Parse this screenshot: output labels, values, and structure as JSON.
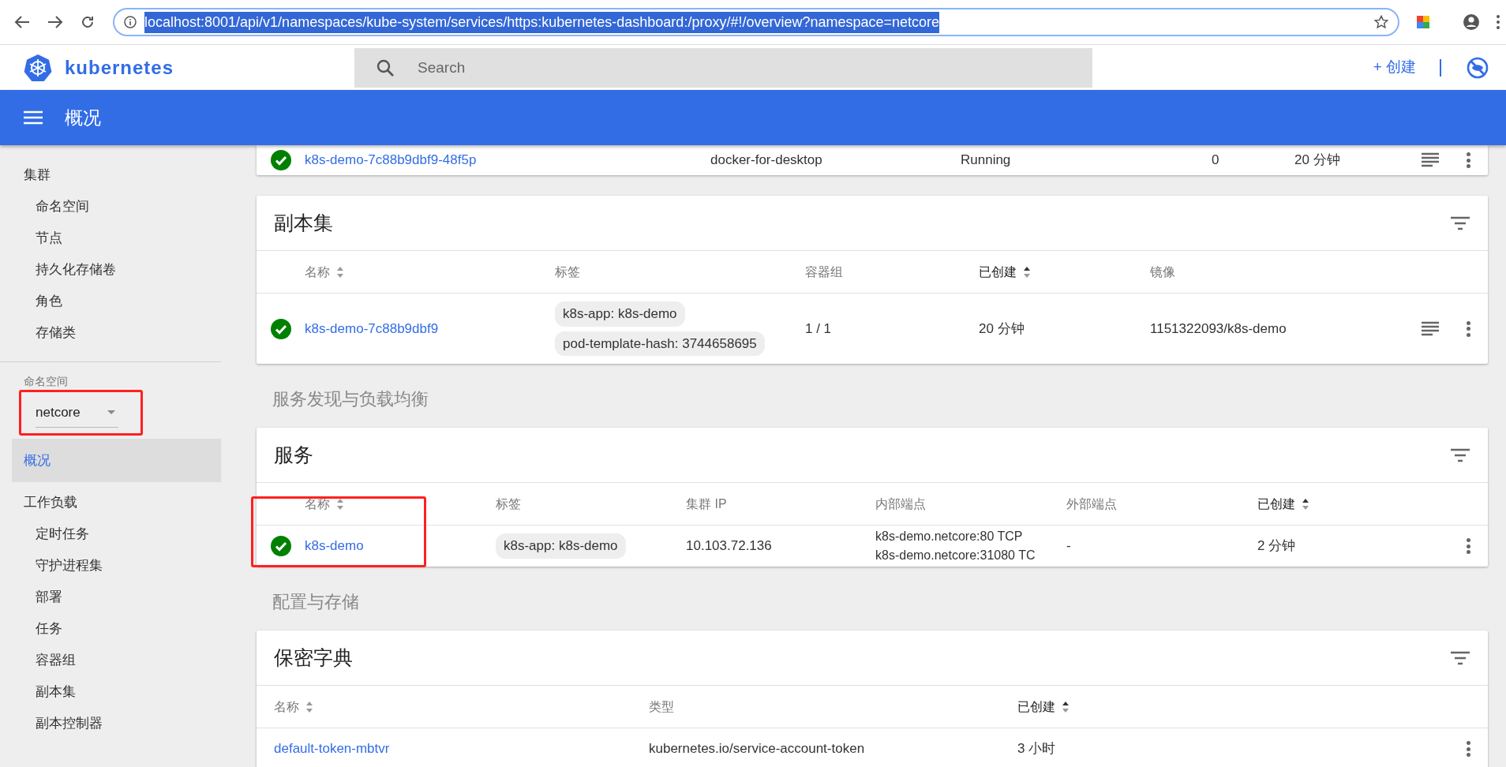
{
  "browser": {
    "url": "localhost:8001/api/v1/namespaces/kube-system/services/https:kubernetes-dashboard:/proxy/#!/overview?namespace=netcore",
    "url_selected": true
  },
  "app_header": {
    "brand": "kubernetes",
    "search": {
      "placeholder": "Search"
    },
    "create_button": "+ 创建"
  },
  "title_bar": {
    "title": "概况"
  },
  "sidebar": {
    "top_sections": [
      {
        "label": "集群",
        "selected": false,
        "children": [
          {
            "label": "命名空间",
            "selected": false
          },
          {
            "label": "节点",
            "selected": false
          },
          {
            "label": "持久化存储卷",
            "selected": false
          },
          {
            "label": "角色",
            "selected": false
          },
          {
            "label": "存储类",
            "selected": false
          }
        ]
      }
    ],
    "namespace_selector": {
      "label": "命名空间",
      "value": "netcore",
      "highlighted": true
    },
    "sections": [
      {
        "label": "概况",
        "selected": true
      },
      {
        "label": "工作负载",
        "selected": false,
        "children": [
          {
            "label": "定时任务",
            "selected": false
          },
          {
            "label": "守护进程集",
            "selected": false
          },
          {
            "label": "部署",
            "selected": false
          },
          {
            "label": "任务",
            "selected": false
          },
          {
            "label": "容器组",
            "selected": false
          },
          {
            "label": "副本集",
            "selected": false
          },
          {
            "label": "副本控制器",
            "selected": false
          }
        ]
      }
    ]
  },
  "main": [
    {
      "kind": "pod_table",
      "rows": [
        {
          "healthy": true,
          "cells": [
            {
              "kind": "link",
              "text": "k8s-demo-7c88b9dbf9-48f5p"
            },
            {
              "kind": "text",
              "text": "docker-for-desktop"
            },
            {
              "kind": "text",
              "text": "Running"
            },
            {
              "kind": "text",
              "text": "0"
            },
            {
              "kind": "text",
              "text": "20 分钟"
            }
          ],
          "logs_button": true,
          "menu_button": true
        }
      ]
    },
    {
      "kind": "replica_set_table",
      "title": "副本集",
      "columns": [
        {
          "label": "名称",
          "sortable": true,
          "sorted": false
        },
        {
          "label": "标签",
          "sortable": false,
          "sorted": false
        },
        {
          "label": "容器组",
          "sortable": false,
          "sorted": false
        },
        {
          "label": "已创建",
          "sortable": true,
          "sorted": true
        },
        {
          "label": "镜像",
          "sortable": false,
          "sorted": false
        }
      ],
      "rows": [
        {
          "healthy": true,
          "cells": [
            {
              "kind": "link",
              "text": "k8s-demo-7c88b9dbf9"
            },
            {
              "kind": "labels",
              "items": [
                "k8s-app: k8s-demo",
                "pod-template-hash: 3744658695"
              ]
            },
            {
              "kind": "text",
              "text": "1 / 1"
            },
            {
              "kind": "text",
              "text": "20 分钟"
            },
            {
              "kind": "text",
              "text": "1151322093/k8s-demo"
            }
          ],
          "logs_button": true,
          "menu_button": true
        }
      ]
    },
    {
      "kind": "section_heading",
      "text": "服务发现与负载均衡"
    },
    {
      "kind": "service_table",
      "title": "服务",
      "columns": [
        {
          "label": "名称",
          "sortable": true,
          "sorted": false
        },
        {
          "label": "标签",
          "sortable": false,
          "sorted": false
        },
        {
          "label": "集群 IP",
          "sortable": false,
          "sorted": false
        },
        {
          "label": "内部端点",
          "sortable": false,
          "sorted": false
        },
        {
          "label": "外部端点",
          "sortable": false,
          "sorted": false
        },
        {
          "label": "已创建",
          "sortable": true,
          "sorted": true
        }
      ],
      "rows": [
        {
          "healthy": true,
          "highlighted": true,
          "cells": [
            {
              "kind": "link",
              "text": "k8s-demo"
            },
            {
              "kind": "labels",
              "items": [
                "k8s-app: k8s-demo"
              ]
            },
            {
              "kind": "text",
              "text": "10.103.72.136"
            },
            {
              "kind": "lines",
              "items": [
                "k8s-demo.netcore:80 TCP",
                "k8s-demo.netcore:31080 TC"
              ]
            },
            {
              "kind": "text",
              "text": "-"
            },
            {
              "kind": "text",
              "text": "2 分钟"
            }
          ],
          "menu_button": true
        }
      ]
    },
    {
      "kind": "section_heading",
      "text": "配置与存储"
    },
    {
      "kind": "secret_table",
      "title": "保密字典",
      "columns": [
        {
          "label": "名称",
          "sortable": true,
          "sorted": false
        },
        {
          "label": "类型",
          "sortable": false,
          "sorted": false
        },
        {
          "label": "已创建",
          "sortable": true,
          "sorted": true
        }
      ],
      "rows": [
        {
          "cells": [
            {
              "kind": "link",
              "text": "default-token-mbtvr"
            },
            {
              "kind": "text",
              "text": "kubernetes.io/service-account-token"
            },
            {
              "kind": "text",
              "text": "3 小时"
            }
          ],
          "menu_button": true
        }
      ]
    }
  ]
}
